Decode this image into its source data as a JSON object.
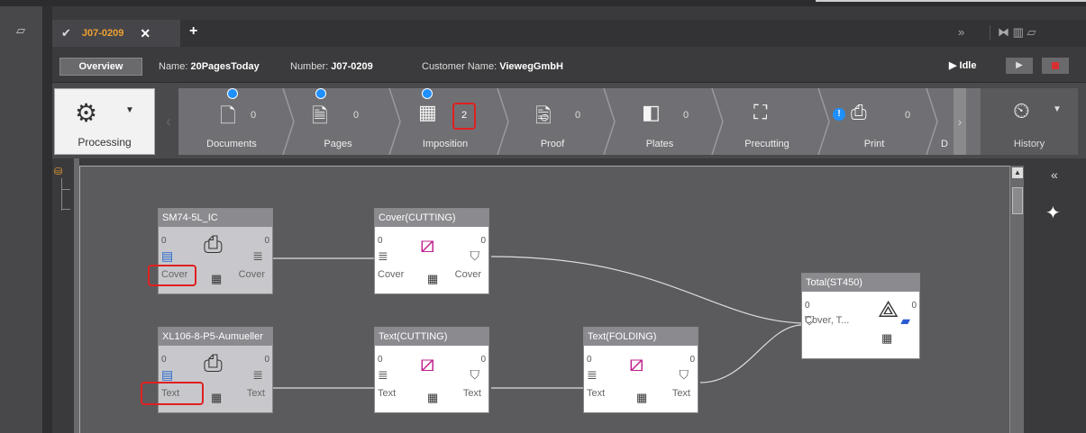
{
  "tabbar": {
    "tab_label": "J07-0209",
    "tab_close": "✕",
    "add_tab": "+",
    "double_chevron": "»",
    "ctl_icons": "⧓ ▥ ▱"
  },
  "infobar": {
    "overview_label": "Overview",
    "name_label": "Name:",
    "name_value": "20PagesToday",
    "number_label": "Number:",
    "number_value": "J07-0209",
    "customer_label": "Customer Name:",
    "customer_value": "ViewegGmbH",
    "status": "Idle"
  },
  "processing": {
    "label": "Processing"
  },
  "history": {
    "label": "History"
  },
  "steps": [
    {
      "label": "Documents",
      "count": "0"
    },
    {
      "label": "Pages",
      "count": "0"
    },
    {
      "label": "Imposition",
      "count": "2"
    },
    {
      "label": "Proof",
      "count": "0"
    },
    {
      "label": "Plates",
      "count": "0"
    },
    {
      "label": "Precutting",
      "count": ""
    },
    {
      "label": "Print",
      "count": "0"
    },
    {
      "label": "D",
      "count": ""
    }
  ],
  "warn_glyph": "!",
  "collapse_glyph": "«",
  "nodes": {
    "sm74": {
      "title": "SM74-5L_IC",
      "in_count": "0",
      "out_count": "0",
      "in_label": "Cover",
      "out_label": "Cover"
    },
    "cover_cutting": {
      "title": "Cover(CUTTING)",
      "in_count": "0",
      "out_count": "0",
      "in_label": "Cover",
      "out_label": "Cover"
    },
    "xl106": {
      "title": "XL106-8-P5-Aumueller",
      "in_count": "0",
      "out_count": "0",
      "in_label": "Text",
      "out_label": "Text"
    },
    "text_cutting": {
      "title": "Text(CUTTING)",
      "in_count": "0",
      "out_count": "0",
      "in_label": "Text",
      "out_label": "Text"
    },
    "text_folding": {
      "title": "Text(FOLDING)",
      "in_count": "0",
      "out_count": "0",
      "in_label": "Text",
      "out_label": "Text"
    },
    "total": {
      "title": "Total(ST450)",
      "in_count": "0",
      "out_count": "0",
      "in_label": "Cover, T..."
    }
  },
  "icons": {
    "process_gear": "gear-cluster-icon",
    "history_clock": "history-clock-icon",
    "press": "printing-press-icon",
    "cutter": "cutter-icon",
    "folder": "folder-icon",
    "binder": "binder-icon"
  },
  "colors": {
    "accent": "#f0a030",
    "highlight": "#e02020",
    "play_dot": "#1e90ff"
  }
}
